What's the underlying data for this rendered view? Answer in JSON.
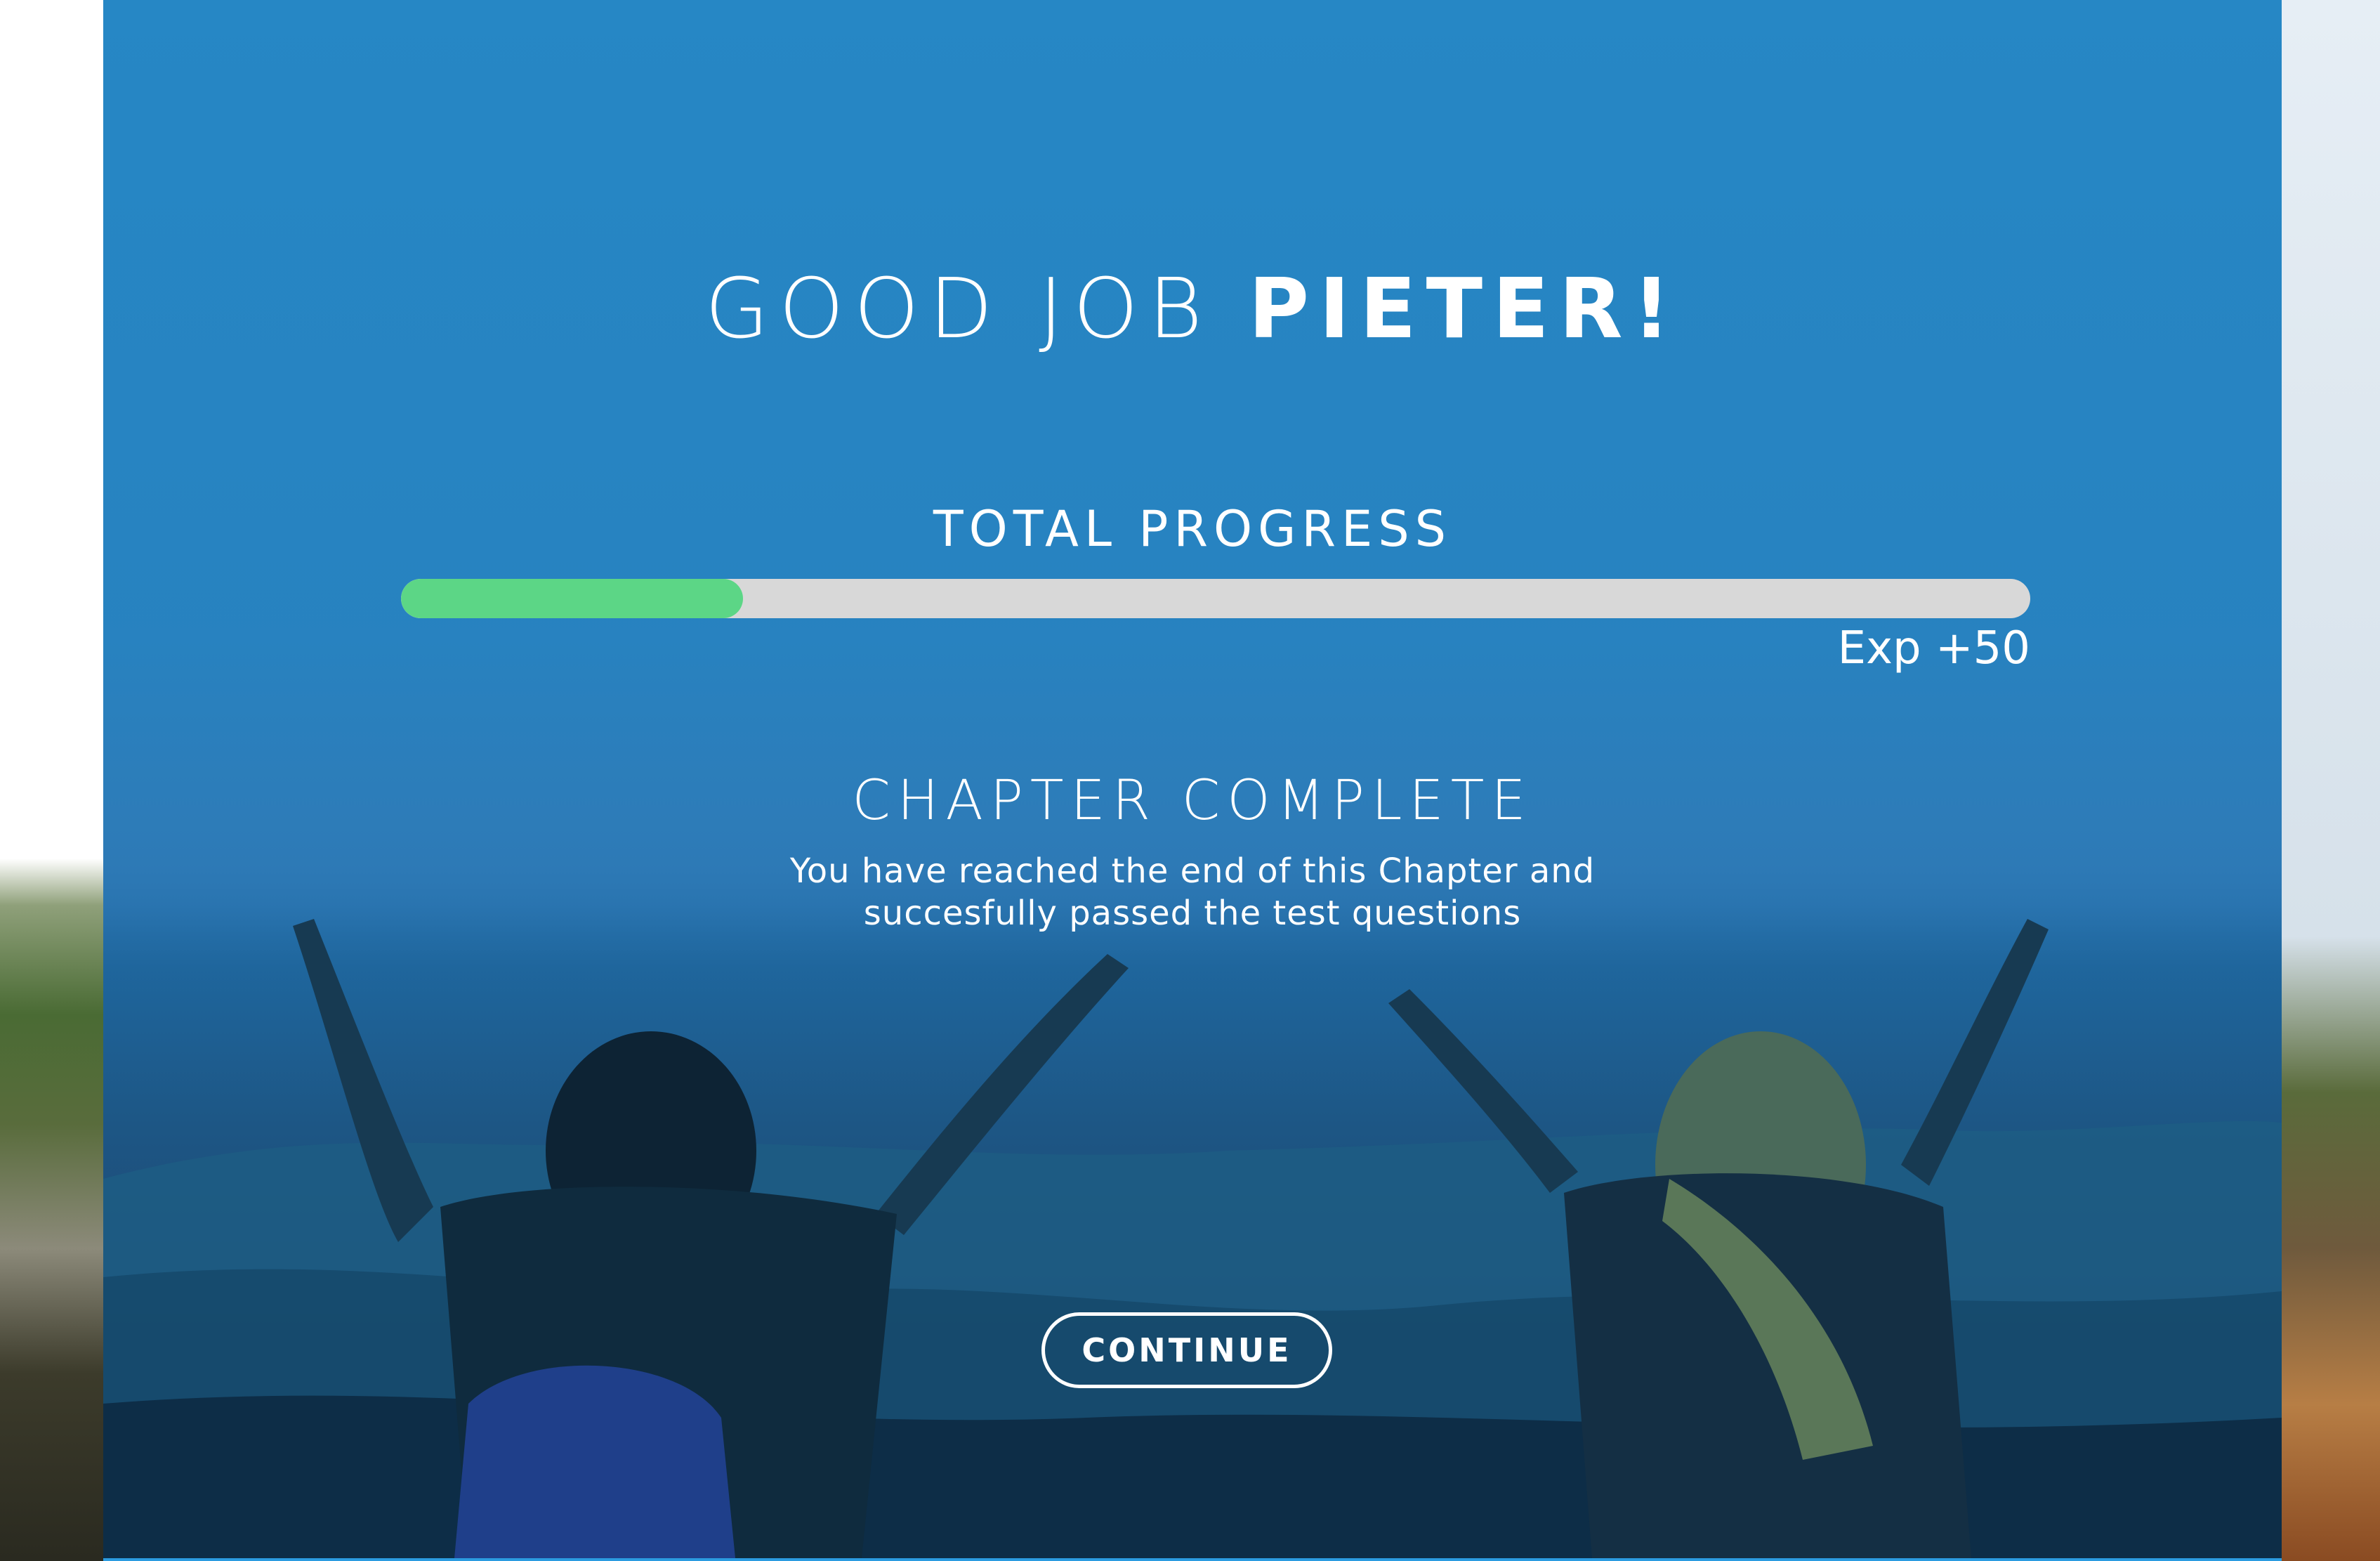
{
  "headline": {
    "prefix": "GOOD JOB ",
    "name": "PIETER!"
  },
  "progress": {
    "title": "TOTAL PROGRESS",
    "fraction": 0.21,
    "exp_label": "Exp +50",
    "fill_color": "#5cd686",
    "track_color": "#d8d8d8"
  },
  "chapter": {
    "title": "CHAPTER COMPLETE",
    "description_line1": "You have reached the end of this Chapter and",
    "description_line2": "succesfully passed the test questions"
  },
  "continue_label": "CONTINUE",
  "colors": {
    "panel_blue": "#2687c5",
    "text": "#ffffff"
  }
}
